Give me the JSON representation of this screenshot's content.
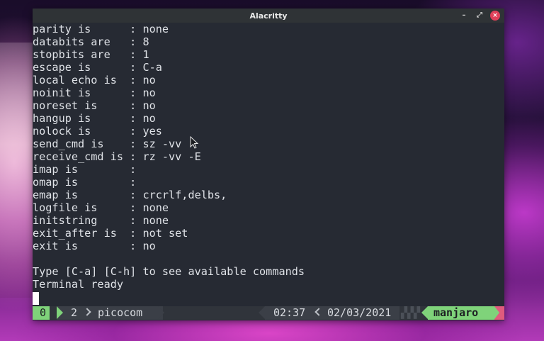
{
  "window": {
    "title": "Alacritty",
    "controls": {
      "minimize": "–",
      "maximize": "⤢",
      "close": "×"
    }
  },
  "terminal": {
    "lines": [
      "parity is      : none",
      "databits are   : 8",
      "stopbits are   : 1",
      "escape is      : C-a",
      "local echo is  : no",
      "noinit is      : no",
      "noreset is     : no",
      "hangup is      : no",
      "nolock is      : yes",
      "send_cmd is    : sz -vv",
      "receive_cmd is : rz -vv -E",
      "imap is        :",
      "omap is        :",
      "emap is        : crcrlf,delbs,",
      "logfile is     : none",
      "initstring     : none",
      "exit_after is  : not set",
      "exit is        : no",
      "",
      "Type [C-a] [C-h] to see available commands",
      "Terminal ready"
    ]
  },
  "statusbar": {
    "window_index": "0",
    "session_number": "2",
    "session_name": "picocom",
    "time": "02:37",
    "date": "02/03/2021",
    "hostname": "manjaro"
  },
  "colors": {
    "terminal_bg": "#262a33",
    "terminal_fg": "#dfe2e7",
    "status_accent": "#7fd37a",
    "close_button": "#e0405a"
  }
}
